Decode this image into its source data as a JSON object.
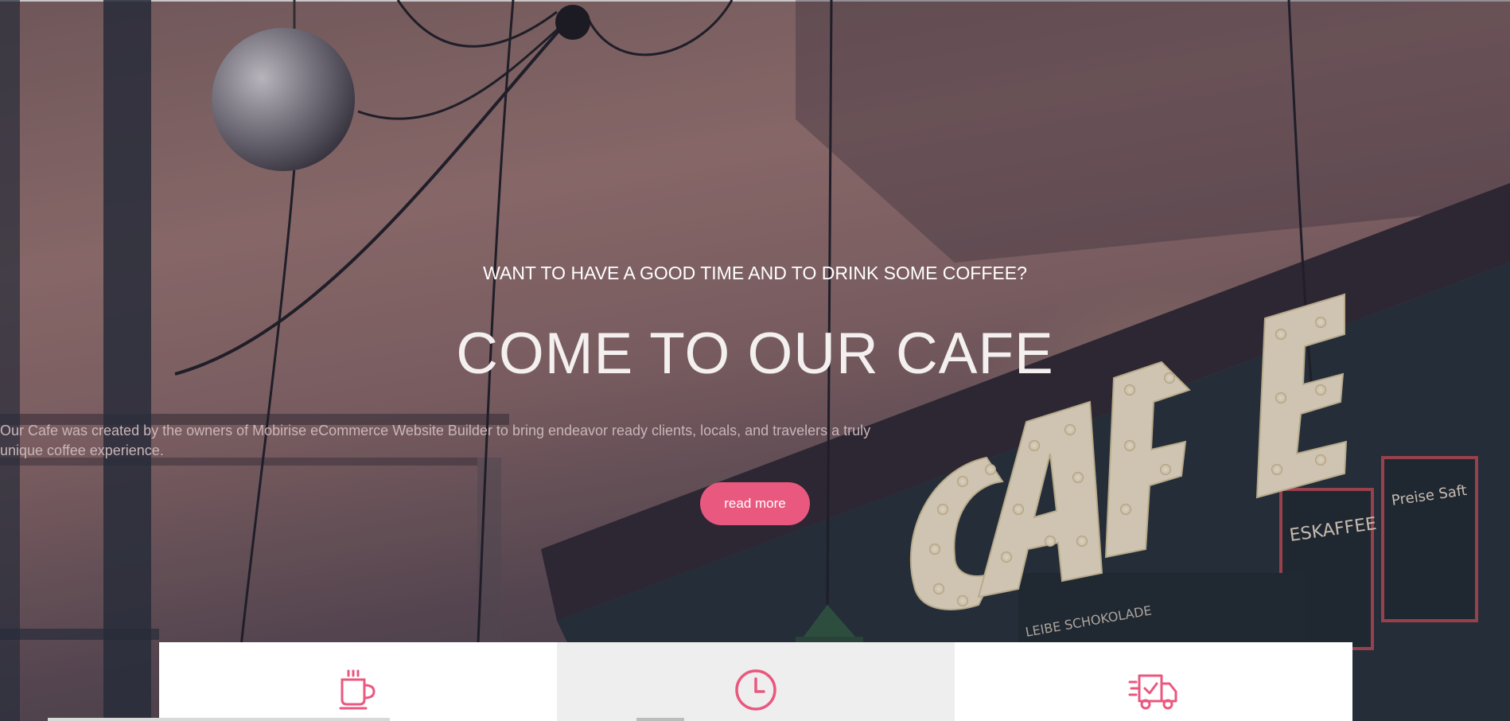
{
  "hero": {
    "subtitle": "WANT TO HAVE A GOOD TIME AND TO DRINK SOME COFFEE?",
    "title": "COME TO OUR CAFE",
    "description": "Our Cafe was created by the owners of Mobirise eCommerce Website Builder to bring endeavor ready clients, locals, and travelers a truly unique coffee experience.",
    "button_label": "read more",
    "sign_text": "CAFE",
    "board_left": "ESKAFFEE",
    "board_right": "Preise Saft",
    "board_bottom": "LEIBE SCHOKOLADE"
  },
  "features": [
    {
      "icon": "coffee-cup-icon"
    },
    {
      "icon": "clock-icon"
    },
    {
      "icon": "delivery-truck-icon"
    }
  ],
  "colors": {
    "accent": "#e9587f",
    "feature_bg": "#ffffff",
    "feature_bg_alt": "#eeeeee"
  }
}
